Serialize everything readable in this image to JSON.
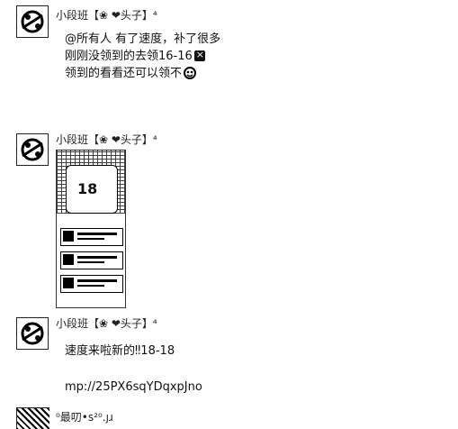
{
  "messages": [
    {
      "sender": "小段班【❀ ❤头子】⁴",
      "lines": [
        "@所有人 有了速度，补了很多",
        "刚刚没领到的去领16-16",
        "领到的看看还可以领不"
      ]
    },
    {
      "sender": "小段班【❀ ❤头子】⁴",
      "image": {
        "big_number": "18"
      }
    },
    {
      "sender": "小段班【❀ ❤头子】⁴",
      "lines": [
        "速度来啦新的‼18-18",
        "mp://25PX6sqYDqxpJno"
      ]
    }
  ],
  "partial": {
    "sender": "⁰最叨•s²⁰.ȷɹ"
  },
  "icons": {
    "mid_line_icon": "close-box-icon",
    "end_line_icon": "smile-face-icon"
  }
}
